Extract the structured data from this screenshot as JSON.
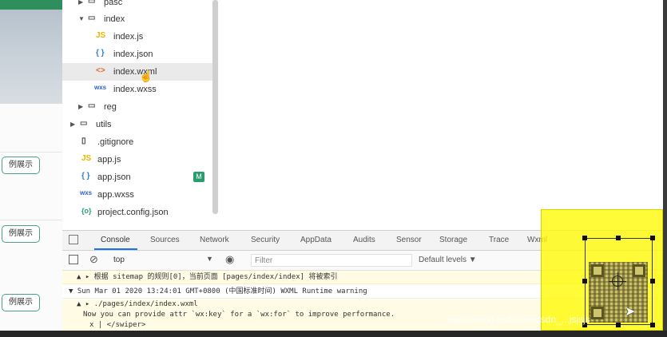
{
  "simulator": {
    "pill_label": "例展示"
  },
  "file_tree": {
    "items": [
      {
        "name": "pasc",
        "type": "folder"
      },
      {
        "name": "index",
        "type": "folder"
      },
      {
        "name": "index.js",
        "icon_text": "JS"
      },
      {
        "name": "index.json",
        "icon_text": "{ }"
      },
      {
        "name": "index.wxml",
        "icon_text": "<>"
      },
      {
        "name": "index.wxss",
        "icon_text": "wxs"
      },
      {
        "name": "reg",
        "type": "folder"
      },
      {
        "name": "utils",
        "type": "folder"
      },
      {
        "name": ".gitignore"
      },
      {
        "name": "app.js",
        "icon_text": "JS"
      },
      {
        "name": "app.json",
        "icon_text": "{ }",
        "badge": "M"
      },
      {
        "name": "app.wxss",
        "icon_text": "wxs"
      },
      {
        "name": "project.config.json",
        "icon_text": "{o}"
      }
    ]
  },
  "devtools": {
    "tabs": [
      "Console",
      "Sources",
      "Network",
      "Security",
      "AppData",
      "Audits",
      "Sensor",
      "Storage",
      "Trace",
      "Wxml"
    ],
    "context": "top",
    "filter_placeholder": "Filter",
    "levels": "Default levels ▼",
    "logs": {
      "line1": "▲ ▸ 根据 sitemap 的规则[0]，当前页面 [pages/index/index] 将被索引",
      "line2": "▼ Sun Mar 01 2020 13:24:01 GMT+0800 (中国标准时间) WXML Runtime warning",
      "line3": "▲ ▸ ./pages/index/index.wxml",
      "line4": "Now you can provide attr `wx:key` for a `wx:for` to improve performance.",
      "line5": "x | </swiper>"
    }
  },
  "watermark": "https://blog.csdn.net/csdn_...jsjsjs"
}
